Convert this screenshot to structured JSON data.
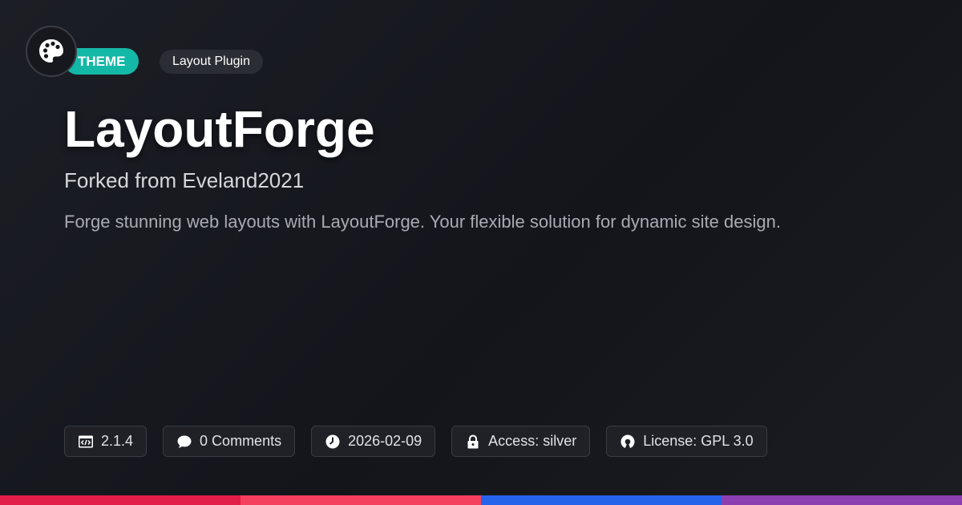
{
  "header": {
    "type_badge": "THEME",
    "category_badge": "Layout Plugin"
  },
  "main": {
    "title": "LayoutForge",
    "subtitle": "Forked from Eveland2021",
    "description": "Forge stunning web layouts with LayoutForge. Your flexible solution for dynamic site design."
  },
  "meta": {
    "version": "2.1.4",
    "comments": "0 Comments",
    "date": "2026-02-09",
    "access": "Access: silver",
    "license": "License: GPL 3.0"
  },
  "icons": {
    "logo": "palette-icon",
    "version": "code-window-icon",
    "comments": "speech-bubble-icon",
    "date": "clock-icon",
    "access": "lock-icon",
    "license": "open-source-icon"
  },
  "colors": {
    "accent": "#14b8a6",
    "bar": [
      "#e11d48",
      "#f43f5e",
      "#2563eb",
      "#8b3fb0"
    ]
  }
}
